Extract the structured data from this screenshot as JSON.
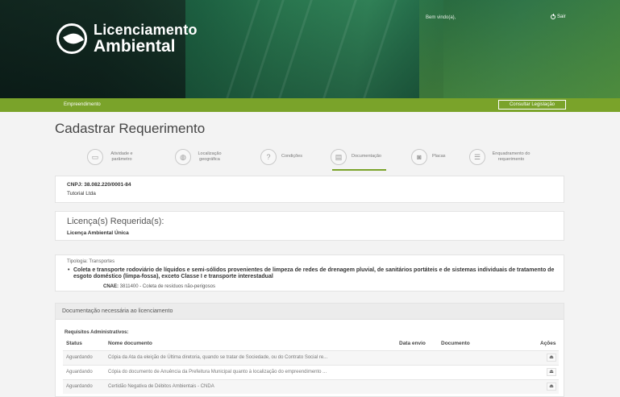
{
  "header": {
    "logo_line1": "Licenciamento",
    "logo_line2": "Ambiental",
    "welcome": "Bem vindo(a),",
    "logout": "Sair"
  },
  "navbar": {
    "section": "Empreendimento",
    "consult_button": "Consultar Legislação"
  },
  "page_title": "Cadastrar Requerimento",
  "steps": [
    {
      "label": "Atividade e parâmetro",
      "icon": "document-icon"
    },
    {
      "label": "Localização geográfica",
      "icon": "globe-icon"
    },
    {
      "label": "Condições",
      "icon": "question-icon"
    },
    {
      "label": "Documentação",
      "icon": "documents-icon",
      "active": true
    },
    {
      "label": "Placas",
      "icon": "vehicle-icon"
    },
    {
      "label": "Enquadramento do requerimento",
      "icon": "checklist-icon"
    }
  ],
  "company": {
    "cnpj": "CNPJ: 38.082.220/0001-84",
    "name": "Tutorial Ltda"
  },
  "license": {
    "heading": "Licença(s) Requerida(s):",
    "value": "Licença Ambiental Única"
  },
  "typology": {
    "label": "Tipologia: Transportes",
    "description": "Coleta e transporte rodoviário de líquidos e semi-sólidos provenientes de limpeza de redes de drenagem pluvial, de sanitários portáteis e de sistemas individuais de tratamento de esgoto doméstico (limpa-fossa), exceto Classe I e transporte interestadual",
    "cnae_label": "CNAE:",
    "cnae_value": "3811400 - Coleta de resíduos não-perigosos"
  },
  "documents": {
    "heading": "Documentação necessária ao licenciamento",
    "subheading": "Requisitos Administrativos:",
    "columns": [
      "Status",
      "Nome documento",
      "Data envio",
      "Documento",
      "Ações"
    ],
    "rows": [
      {
        "status": "Aguardando",
        "name": "Cópia da Ata da eleição de Última diretoria, quando se tratar de Sociedade, ou do Contrato Social re...",
        "action_icon": "upload-icon"
      },
      {
        "status": "Aguardando",
        "name": "Cópia do documento de Anuência da Prefeitura Municipal quanto à localização do empreendimento ...",
        "action_icon": "upload-icon"
      },
      {
        "status": "Aguardando",
        "name": "Certidão Negativa de Débitos Ambientais - CNDA",
        "action_icon": "upload-icon"
      }
    ]
  },
  "colors": {
    "accent_green": "#7aa32a",
    "banner_dark": "#123a27"
  }
}
